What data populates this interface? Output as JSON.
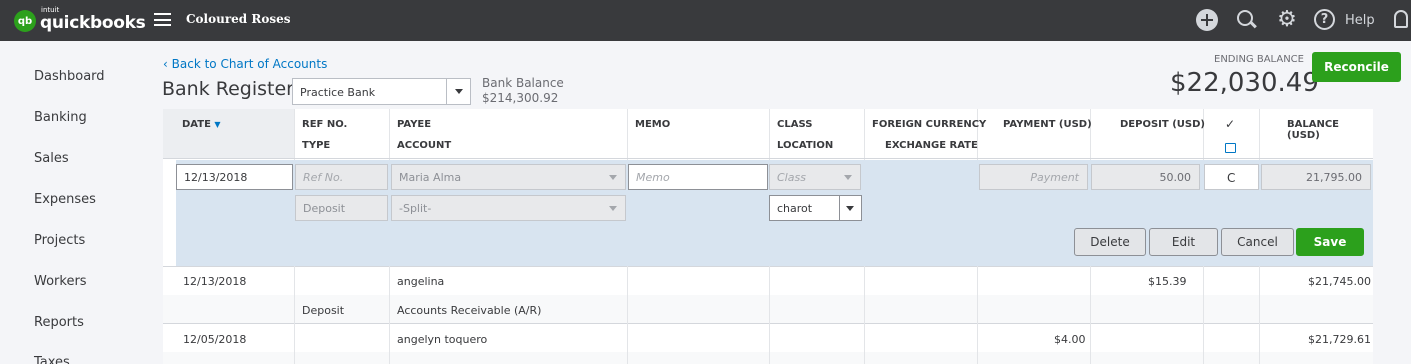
{
  "header": {
    "logo_intuit": "intuit",
    "logo_word": "quickbooks",
    "logo_mark": "qb",
    "company": "Coloured Roses",
    "help_label": "Help",
    "icons": [
      "plus-icon",
      "search-icon",
      "gear-icon",
      "help-icon",
      "bell-icon"
    ]
  },
  "sidebar": {
    "items": [
      {
        "label": "Dashboard"
      },
      {
        "label": "Banking"
      },
      {
        "label": "Sales"
      },
      {
        "label": "Expenses"
      },
      {
        "label": "Projects"
      },
      {
        "label": "Workers"
      },
      {
        "label": "Reports"
      },
      {
        "label": "Taxes"
      }
    ]
  },
  "page": {
    "back_link": "Back to Chart of Accounts",
    "back_arrow": "‹",
    "title": "Bank Register",
    "account_select": "Practice Bank",
    "bank_balance_label": "Bank Balance",
    "bank_balance_value": "$214,300.92",
    "ending_balance_label": "ENDING BALANCE",
    "ending_balance_value": "$22,030.49",
    "reconcile_label": "Reconcile"
  },
  "columns": {
    "date": "DATE",
    "date_sort": "▼",
    "ref_no": "REF NO.",
    "type": "TYPE",
    "payee": "PAYEE",
    "account": "ACCOUNT",
    "memo": "MEMO",
    "class": "CLASS",
    "location": "LOCATION",
    "foreign_currency": "FOREIGN CURRENCY",
    "exchange_rate": "EXCHANGE RATE",
    "payment": "PAYMENT (USD)",
    "deposit": "DEPOSIT (USD)",
    "check": "✓",
    "balance": "BALANCE (USD)"
  },
  "edit_row": {
    "date": "12/13/2018",
    "ref_placeholder": "Ref No.",
    "payee": "Maria Alma",
    "memo_placeholder": "Memo",
    "class_placeholder": "Class",
    "payment_placeholder": "Payment",
    "deposit": "50.00",
    "cleared": "C",
    "balance": "21,795.00",
    "type": "Deposit",
    "account": "-Split-",
    "location": "charot",
    "buttons": {
      "delete": "Delete",
      "edit": "Edit",
      "cancel": "Cancel",
      "save": "Save"
    }
  },
  "rows": [
    {
      "date": "12/13/2018",
      "type": "Deposit",
      "payee": "angelina",
      "account": "Accounts Receivable (A/R)",
      "payment": "",
      "deposit": "$15.39",
      "balance": "$21,745.00"
    },
    {
      "date": "12/05/2018",
      "type": "",
      "payee": "angelyn toquero",
      "account": "",
      "payment": "$4.00",
      "deposit": "",
      "balance": "$21,729.61"
    }
  ]
}
